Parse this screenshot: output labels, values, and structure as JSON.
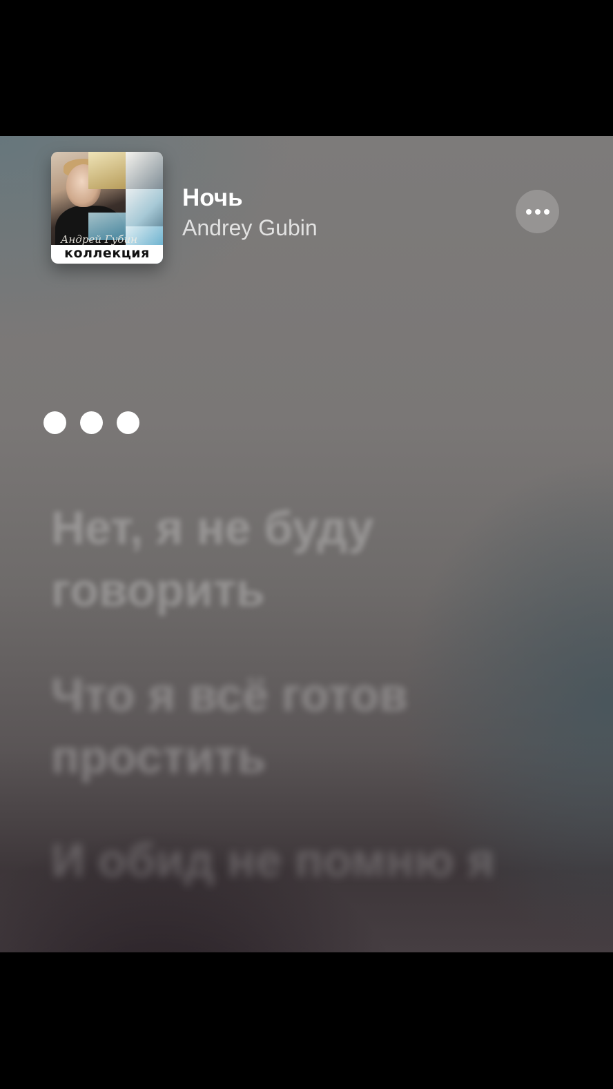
{
  "now_playing": {
    "title": "Ночь",
    "artist": "Andrey Gubin",
    "artwork": {
      "script_text": "Андрей Губин",
      "word": "коллекция"
    },
    "more_icon": "ellipsis-icon"
  },
  "lyrics": {
    "waiting_indicator_icon": "ellipsis-dots-icon",
    "lines": [
      "Нет, я не буду говорить",
      "Что я всё готов простить",
      "И обид не помню я"
    ]
  },
  "colors": {
    "background_top": "#7d7b7a",
    "background_bottom": "#463e42",
    "text_primary": "#ffffff"
  }
}
